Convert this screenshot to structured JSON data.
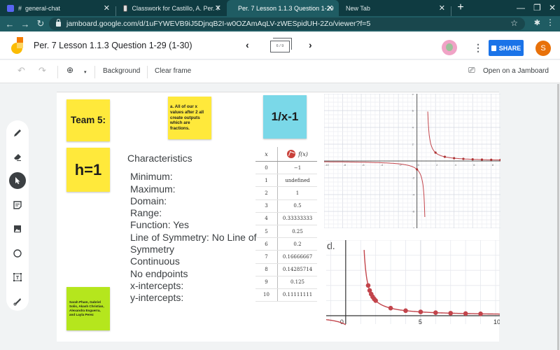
{
  "browser": {
    "tabs": [
      {
        "label": "# ⁣ general-chat",
        "active": false
      },
      {
        "label": "Classwork for Castillo, A. Per. 7",
        "active": false
      },
      {
        "label": "Per. 7 Lesson 1.1.3 Question 1-29",
        "active": true
      },
      {
        "label": "New Tab",
        "active": false
      }
    ],
    "url": "jamboard.google.com/d/1uFYWEVB9iJ5DjnqB2I-w0OZAmAqLV-zWESpidUH-2Zo/viewer?f=5"
  },
  "app": {
    "title": "Per. 7 Lesson 1.1.3 Question 1-29 (1-30)",
    "frame_counter": "6 / 9",
    "share_label": "SHARE",
    "user_initial": "S",
    "toolbar": {
      "background_label": "Background",
      "clear_frame_label": "Clear frame",
      "open_on_jamboard_label": "Open on a Jamboard"
    }
  },
  "board": {
    "sticky_team": "Team 5:",
    "sticky_note_a": "a. All of our x values after 2 all create outputs which are fractions.",
    "sticky_function": "1/x-1",
    "sticky_h": "h=1",
    "sticky_names": "Sarah Pham, Gabriel Solis, Akash Christian, Alexandra Esguerra, and Layla Perez",
    "characteristics_title": "Characteristics",
    "characteristics": [
      "Minimum:",
      "Maximum:",
      "Domain:",
      "Range:",
      "Function: Yes",
      "Line of Symmetry: No Line of Symmetry",
      "Continuous",
      "No endpoints",
      "x-intercepts:",
      "y-intercepts:"
    ],
    "d_label": "d."
  },
  "colors": {
    "sticky_yellow": "#ffe93b",
    "sticky_blue": "#7ad8e8",
    "sticky_green": "#b5e61d",
    "curve_red": "#c2444b",
    "share_blue": "#1a73e8",
    "avatar_orange": "#e8710a"
  },
  "chart_data": [
    {
      "type": "table",
      "columns": [
        "x",
        "f(x)"
      ],
      "rows": [
        [
          "0",
          "−1"
        ],
        [
          "1",
          "undefined"
        ],
        [
          "2",
          "1"
        ],
        [
          "3",
          "0.5"
        ],
        [
          "4",
          "0.33333333"
        ],
        [
          "5",
          "0.25"
        ],
        [
          "6",
          "0.2"
        ],
        [
          "7",
          "0.16666667"
        ],
        [
          "8",
          "0.14285714"
        ],
        [
          "9",
          "0.125"
        ],
        [
          "10",
          "0.11111111"
        ]
      ]
    },
    {
      "type": "line",
      "title": "",
      "function": "1/(x-1)",
      "xlim": [
        -10,
        9
      ],
      "ylim": [
        -8,
        8
      ],
      "x_ticks": [
        -10,
        -8,
        -6,
        -4,
        -2,
        0,
        2,
        4,
        6,
        8
      ],
      "y_ticks": [
        -8,
        -6,
        -4,
        -2,
        2,
        4,
        6,
        8
      ],
      "grid": true,
      "points": [
        [
          0,
          -1
        ],
        [
          2,
          1
        ],
        [
          3,
          0.5
        ],
        [
          4,
          0.333
        ],
        [
          5,
          0.25
        ],
        [
          6,
          0.2
        ],
        [
          7,
          0.167
        ],
        [
          8,
          0.143
        ],
        [
          9,
          0.125
        ]
      ]
    },
    {
      "type": "scatter",
      "title": "",
      "function": "1/(x-1)",
      "xlim": [
        -1,
        10
      ],
      "ylim": [
        -0.5,
        5
      ],
      "x_ticks": [
        0,
        5,
        10
      ],
      "grid": true,
      "points": [
        [
          1.5,
          2
        ],
        [
          1.6,
          1.67
        ],
        [
          1.7,
          1.43
        ],
        [
          1.8,
          1.25
        ],
        [
          1.9,
          1.11
        ],
        [
          2,
          1
        ],
        [
          3,
          0.5
        ],
        [
          4,
          0.333
        ],
        [
          5,
          0.25
        ],
        [
          6,
          0.2
        ],
        [
          7,
          0.167
        ],
        [
          8,
          0.143
        ],
        [
          9,
          0.125
        ]
      ]
    }
  ]
}
